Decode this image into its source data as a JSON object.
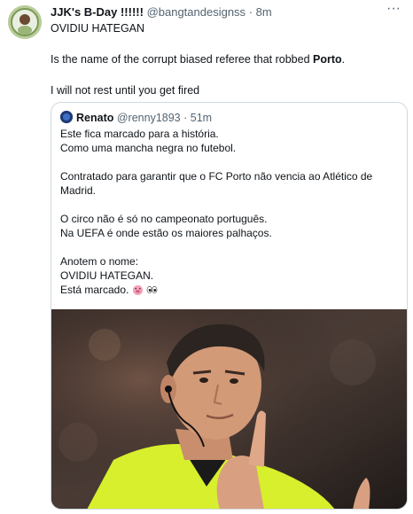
{
  "tweet": {
    "author_name": "JJK's B-Day !!!!!!",
    "author_handle": "@bangtandesignss",
    "separator": "·",
    "time": "8m",
    "more_label": "···",
    "lines": [
      "OVIDIU HATEGAN",
      "Is the name of the corrupt biased referee that robbed ",
      "Porto",
      ".",
      "I will not rest until you get fired"
    ]
  },
  "quote": {
    "author_name": "Renato",
    "author_handle": "@renny1893",
    "separator": "·",
    "time": "51m",
    "paragraphs": [
      [
        "Este fica marcado para a história.",
        "Como uma mancha negra no futebol."
      ],
      [
        "Contratado para garantir que o FC Porto não vencia ao Atlético de",
        "Madrid."
      ],
      [
        "O circo não é só no campeonato português.",
        "Na UEFA é onde estão os maiores palhaços."
      ],
      [
        "Anotem o nome:",
        "OVIDIU HATEGAN.",
        "Está marcado."
      ]
    ],
    "emojis": [
      "pig-face-emoji",
      "eyes-emoji"
    ]
  },
  "colors": {
    "text": "#0f1419",
    "muted": "#536471",
    "border": "#cfd9de",
    "referee_shirt": "#d7ef2c"
  }
}
